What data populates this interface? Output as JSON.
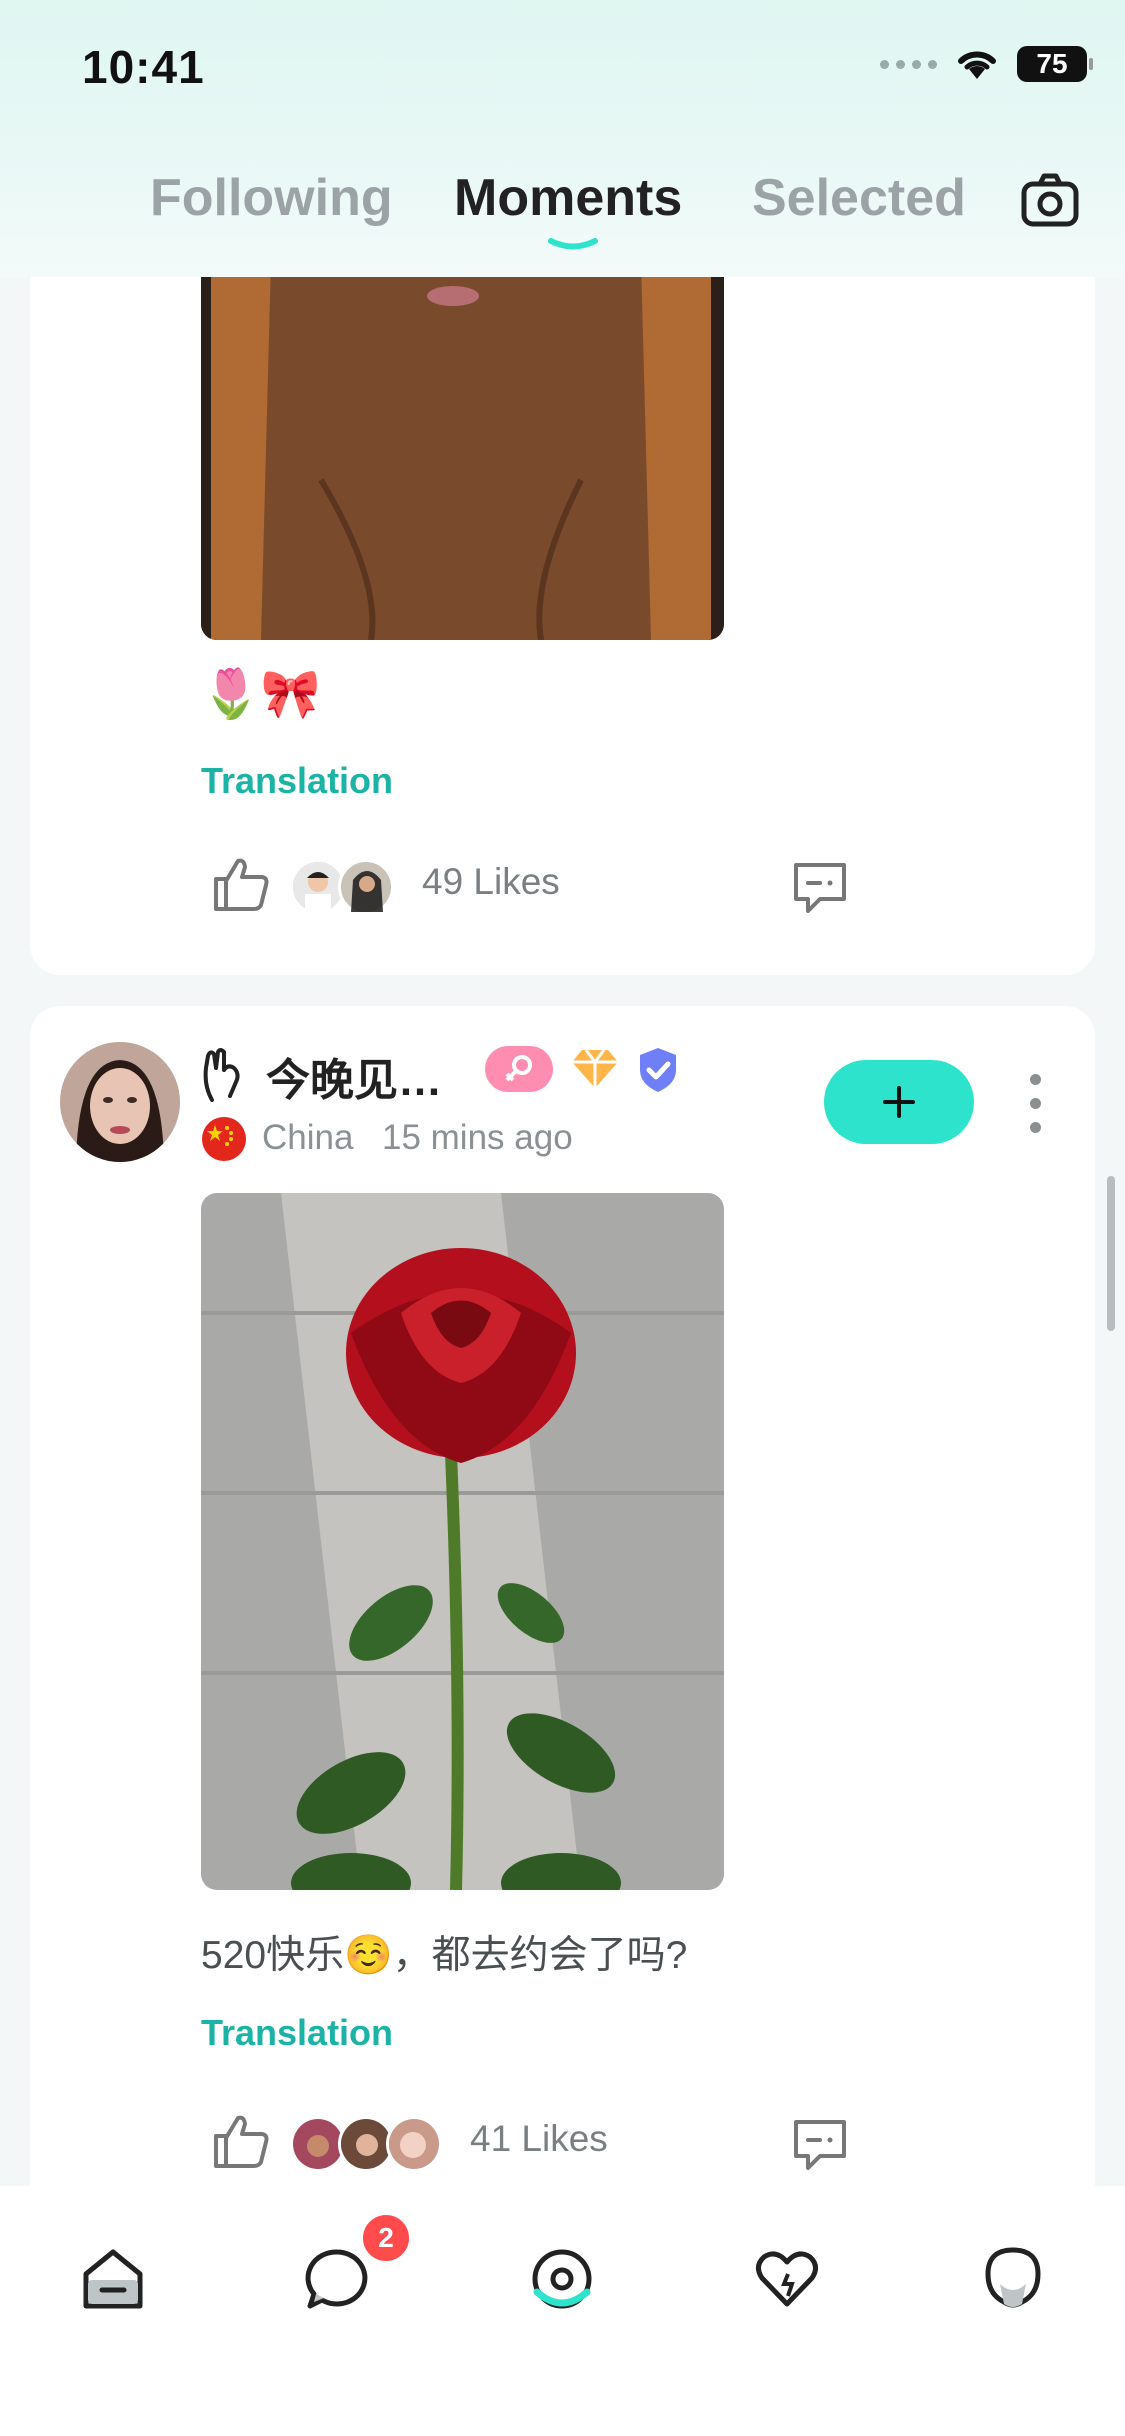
{
  "status": {
    "time": "10:41",
    "battery": "75"
  },
  "tabs": [
    {
      "label": "Following"
    },
    {
      "label": "Moments"
    },
    {
      "label": "Selected"
    }
  ],
  "posts": [
    {
      "emoji": "🌷🎀",
      "translation": "Translation",
      "likes": "49 Likes"
    },
    {
      "username": "今晚见…",
      "country": "China",
      "time_ago": "15 mins ago",
      "text": "520快乐☺️，都去约会了吗?",
      "translation": "Translation",
      "likes": "41 Likes"
    }
  ],
  "nav": {
    "messages_badge": "2"
  },
  "colors": {
    "accent": "#2ee3cc",
    "translation": "#1ab3a6",
    "badge": "#ff4b4b"
  },
  "icons": [
    "camera-icon",
    "like-icon",
    "comment-icon",
    "more-icon",
    "plus-icon",
    "home-icon",
    "chat-icon",
    "moments-icon",
    "heart-icon",
    "profile-icon",
    "flag-icon",
    "verified-icon",
    "diamond-icon",
    "female-icon",
    "wave-icon"
  ]
}
